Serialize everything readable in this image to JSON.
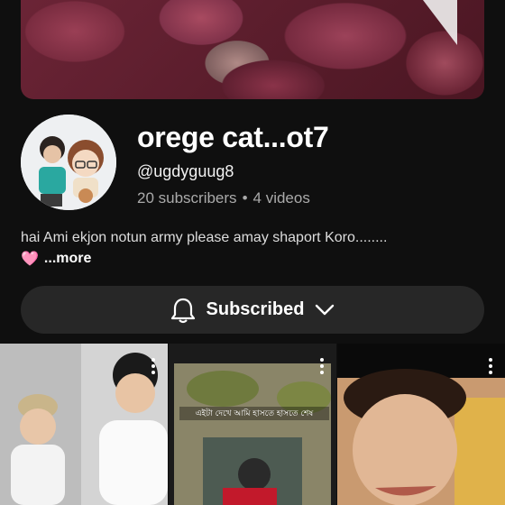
{
  "channel": {
    "name": "orege cat...ot7",
    "handle": "@ugdyguug8",
    "subscribers": "20 subscribers",
    "separator": "•",
    "videos": "4 videos",
    "description": "hai Ami ekjon notun army please amay shaport Koro........",
    "more_label": "...more",
    "heart_emoji": "🩷"
  },
  "subscribe": {
    "label": "Subscribed",
    "bell_icon": "bell-icon",
    "chevron_icon": "chevron-down-icon"
  },
  "thumbnails": [
    {
      "menu_icon": "more-vert-icon",
      "caption": ""
    },
    {
      "menu_icon": "more-vert-icon",
      "caption": "এইটা দেখে আমি হাসতে হাসতে শেষ"
    },
    {
      "menu_icon": "more-vert-icon",
      "caption": ""
    }
  ],
  "colors": {
    "background": "#0f0f0f",
    "button_bg": "#272727",
    "secondary_text": "#aaaaaa"
  }
}
